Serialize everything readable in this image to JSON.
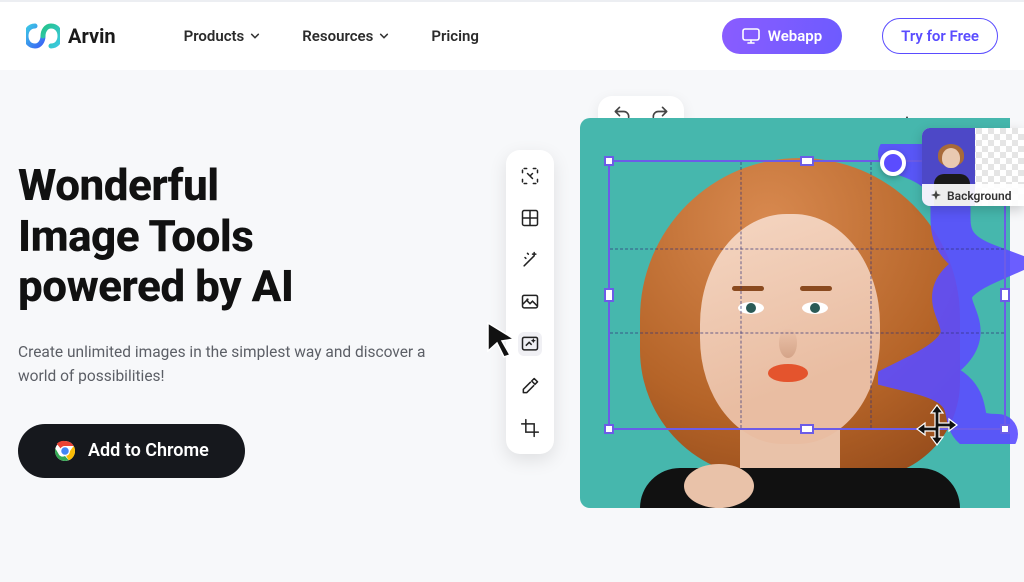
{
  "brand": {
    "name": "Arvin"
  },
  "nav": {
    "products": "Products",
    "resources": "Resources",
    "pricing": "Pricing"
  },
  "cta": {
    "webapp": "Webapp",
    "try_free": "Try for Free",
    "add_chrome": "Add to Chrome"
  },
  "hero": {
    "title_line1": "Wonderful",
    "title_line2": "Image Tools",
    "title_line3": "powered by AI",
    "subtitle": "Create unlimited images in the simplest way and discover a world of possibilities!"
  },
  "editor": {
    "thumb_label": "Background",
    "tools": [
      "ai-select-tool",
      "grid-tool",
      "magic-wand-tool",
      "image-enhance-tool",
      "generative-fill-tool",
      "eyedropper-tool",
      "crop-tool"
    ]
  },
  "colors": {
    "accent": "#5b4cff",
    "canvas": "#46b7ad",
    "brand_grad_a": "#3cc9e5",
    "brand_grad_b": "#3a62f5",
    "brand_grad_c": "#24c38a"
  }
}
